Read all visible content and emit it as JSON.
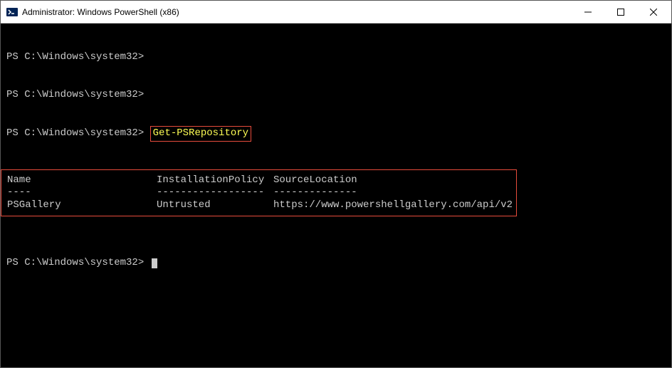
{
  "window": {
    "title": "Administrator: Windows PowerShell (x86)"
  },
  "terminal": {
    "prompt": "PS C:\\Windows\\system32>",
    "command": "Get-PSRepository",
    "headers": {
      "name": "Name",
      "policy": "InstallationPolicy",
      "source": "SourceLocation"
    },
    "dividers": {
      "name": "----",
      "policy": "------------------",
      "source": "--------------"
    },
    "rows": [
      {
        "name": "PSGallery",
        "policy": "Untrusted",
        "source": "https://www.powershellgallery.com/api/v2"
      }
    ]
  }
}
